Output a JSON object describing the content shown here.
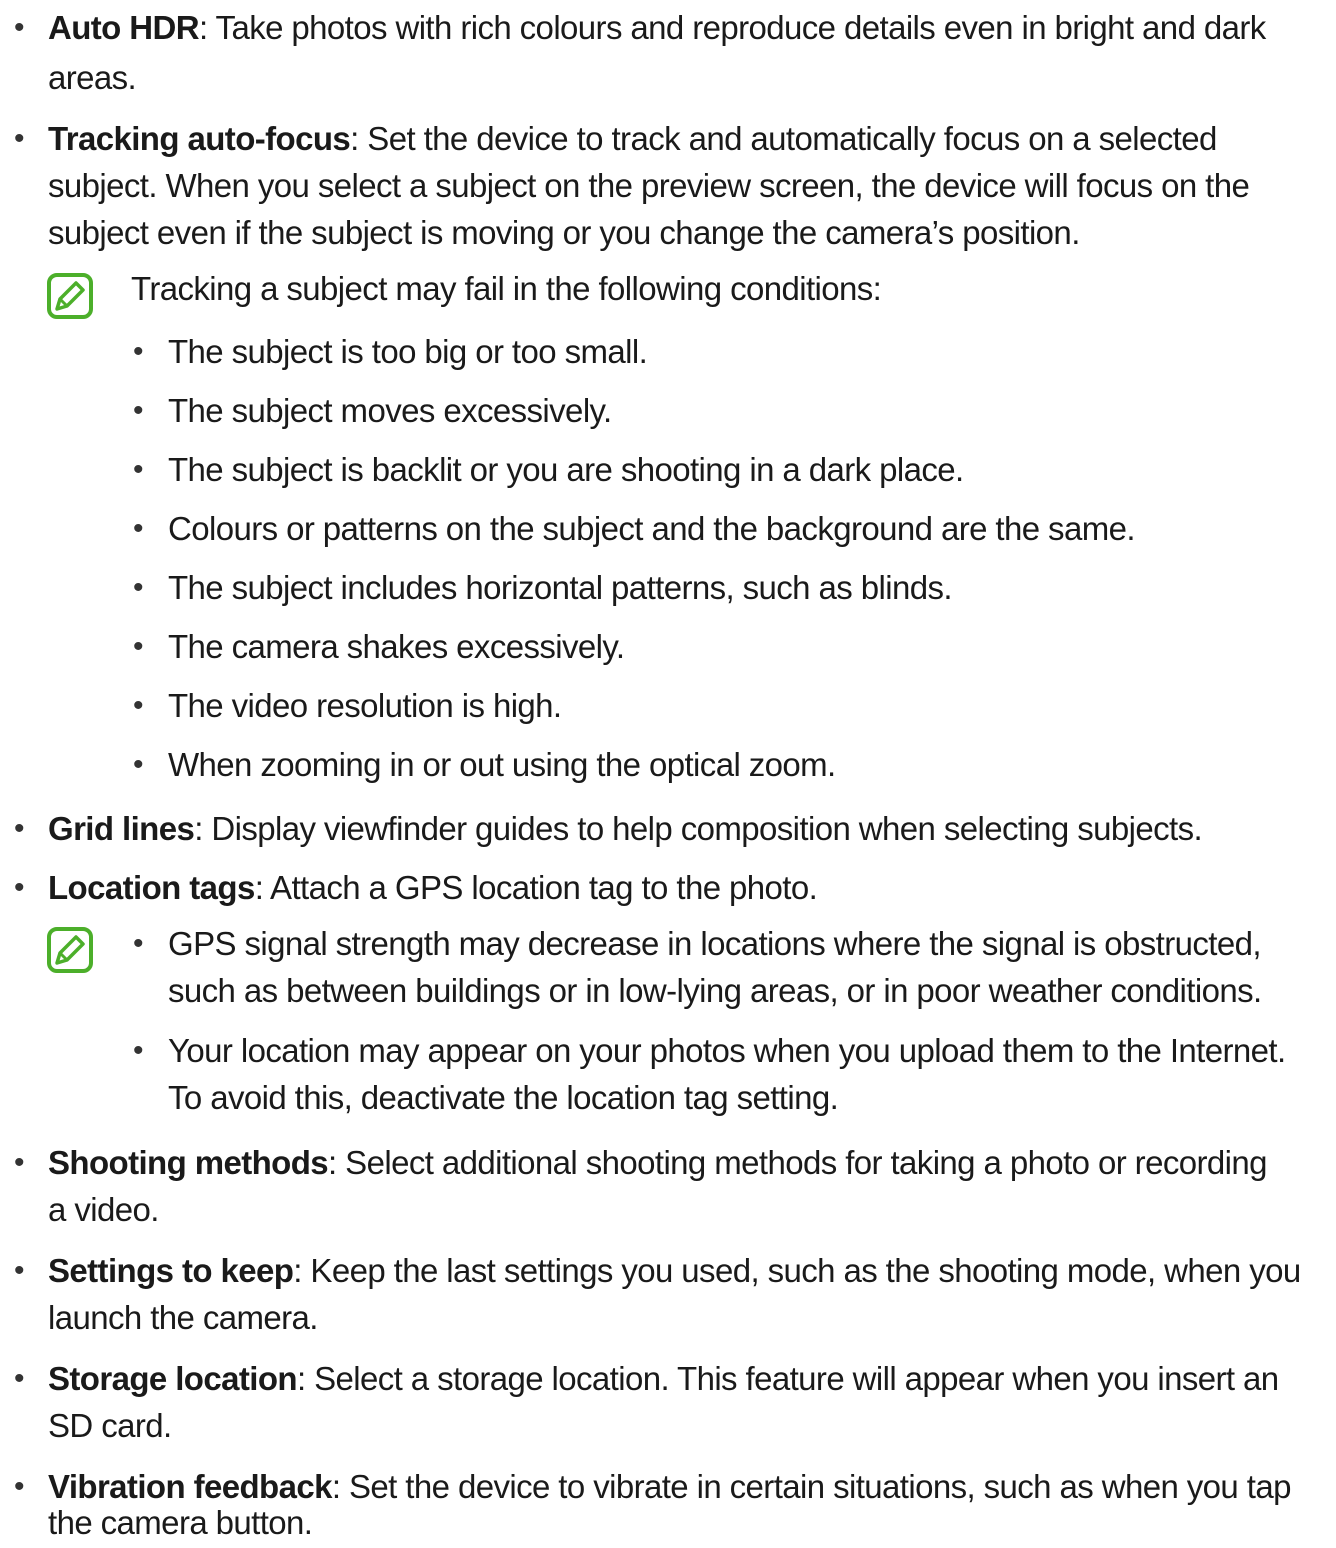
{
  "colors": {
    "text": "#1a1a1a",
    "note_icon": "#4caf2a"
  },
  "icons": {
    "note": "note-pencil-icon"
  },
  "items": {
    "auto_hdr": {
      "term": "Auto HDR",
      "line1": ": Take photos with rich colours and reproduce details even in bright and dark",
      "line2": "areas."
    },
    "tracking": {
      "term": "Tracking auto-focus",
      "line1": ": Set the device to track and automatically focus on a selected",
      "line2": "subject. When you select a subject on the preview screen, the device will focus on the",
      "line3": "subject even if the subject is moving or you change the camera’s position.",
      "note_intro": "Tracking a subject may fail in the following conditions:",
      "conditions": [
        "The subject is too big or too small.",
        "The subject moves excessively.",
        "The subject is backlit or you are shooting in a dark place.",
        "Colours or patterns on the subject and the background are the same.",
        "The subject includes horizontal patterns, such as blinds.",
        "The camera shakes excessively.",
        "The video resolution is high.",
        "When zooming in or out using the optical zoom."
      ]
    },
    "grid_lines": {
      "term": "Grid lines",
      "line1": ": Display viewfinder guides to help composition when selecting subjects."
    },
    "location_tags": {
      "term": "Location tags",
      "line1": ": Attach a GPS location tag to the photo.",
      "notes": [
        {
          "line1": "GPS signal strength may decrease in locations where the signal is obstructed,",
          "line2": "such as between buildings or in low-lying areas, or in poor weather conditions."
        },
        {
          "line1": "Your location may appear on your photos when you upload them to the Internet.",
          "line2": "To avoid this, deactivate the location tag setting."
        }
      ]
    },
    "shooting_methods": {
      "term": "Shooting methods",
      "line1": ": Select additional shooting methods for taking a photo or recording",
      "line2": "a video."
    },
    "settings_to_keep": {
      "term": "Settings to keep",
      "line1": ": Keep the last settings you used, such as the shooting mode, when you",
      "line2": "launch the camera."
    },
    "storage_location": {
      "term": "Storage location",
      "line1": ": Select a storage location. This feature will appear when you insert an",
      "line2": "SD card."
    },
    "vibration_feedback": {
      "term": "Vibration feedback",
      "line1": ": Set the device to vibrate in certain situations, such as when you tap",
      "line2": "the camera button."
    }
  }
}
